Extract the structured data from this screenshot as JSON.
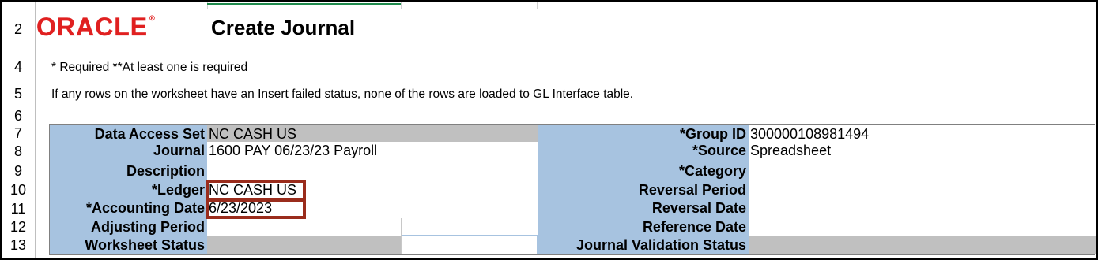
{
  "row_headers": [
    "2",
    "4",
    "5",
    "6",
    "7",
    "8",
    "9",
    "10",
    "11",
    "12",
    "13"
  ],
  "logo": {
    "text": "ORACLE",
    "mark": "®"
  },
  "page_title": "Create Journal",
  "notes": {
    "required": "* Required  **At least one is required",
    "insert_failed": "If any rows on the worksheet have an Insert failed status, none of the rows are loaded to GL Interface table."
  },
  "left_fields": [
    {
      "label": "Data Access Set",
      "value": "NC CASH US"
    },
    {
      "label": "Journal",
      "value": "1600 PAY 06/23/23 Payroll"
    },
    {
      "label": "Description",
      "value": ""
    },
    {
      "label": "*Ledger",
      "value": "NC CASH US"
    },
    {
      "label": "*Accounting Date",
      "value": "6/23/2023"
    },
    {
      "label": "Adjusting Period",
      "value": ""
    },
    {
      "label": "Worksheet Status",
      "value": ""
    }
  ],
  "right_fields": [
    {
      "label": "*Group ID",
      "value": "300000108981494"
    },
    {
      "label": "*Source",
      "value": "Spreadsheet"
    },
    {
      "label": "*Category",
      "value": ""
    },
    {
      "label": "Reversal Period",
      "value": ""
    },
    {
      "label": "Reversal Date",
      "value": ""
    },
    {
      "label": "Reference Date",
      "value": ""
    },
    {
      "label": "Journal Validation Status",
      "value": ""
    }
  ],
  "colors": {
    "brand_red": "#e02020",
    "label_bg": "#a7c3e0",
    "highlight": "#9a2c1c",
    "gray_cell": "#c0c0c0"
  }
}
